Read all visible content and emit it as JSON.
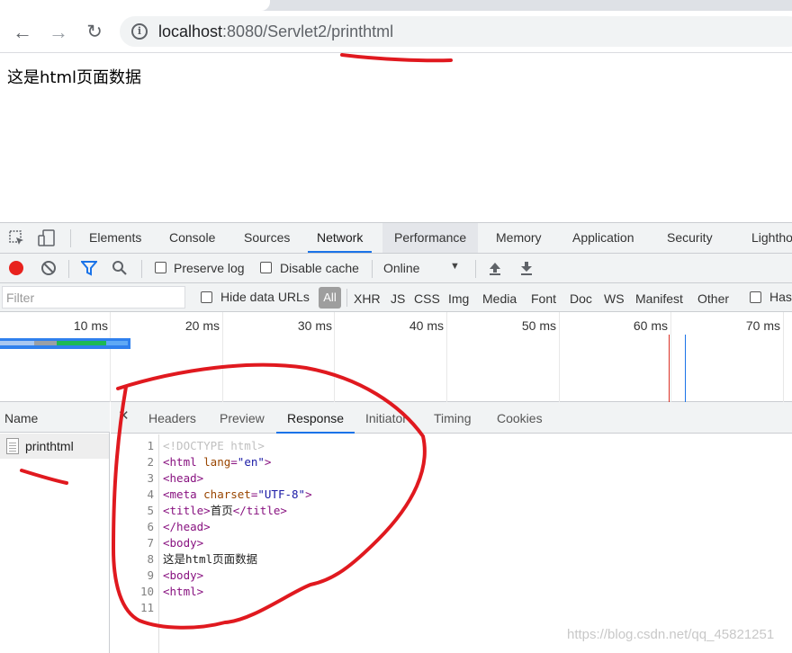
{
  "browser": {
    "url_host": "localhost",
    "url_rest": ":8080/Servlet2/printhtml"
  },
  "page": {
    "text": "这是html页面数据"
  },
  "devtools": {
    "tabs": [
      "Elements",
      "Console",
      "Sources",
      "Network",
      "Performance",
      "Memory",
      "Application",
      "Security",
      "Lighthou"
    ],
    "active_tab": "Network",
    "network_toolbar": {
      "preserve_log": "Preserve log",
      "disable_cache": "Disable cache",
      "throttling": "Online"
    },
    "filter_bar": {
      "placeholder": "Filter",
      "hide_data_urls": "Hide data URLs",
      "all": "All",
      "types": [
        "XHR",
        "JS",
        "CSS",
        "Img",
        "Media",
        "Font",
        "Doc",
        "WS",
        "Manifest",
        "Other"
      ],
      "has": "Has"
    },
    "timeline_ticks": [
      "10 ms",
      "20 ms",
      "30 ms",
      "40 ms",
      "50 ms",
      "60 ms",
      "70 ms"
    ],
    "name_column": {
      "header": "Name",
      "request": "printhtml"
    },
    "detail_tabs": [
      "Headers",
      "Preview",
      "Response",
      "Initiator",
      "Timing",
      "Cookies"
    ],
    "active_detail_tab": "Response",
    "response_lines": [
      {
        "n": "1",
        "parts": [
          {
            "c": "t-doc",
            "t": "<!DOCTYPE html>"
          }
        ]
      },
      {
        "n": "2",
        "parts": [
          {
            "c": "t-tag",
            "t": "<html "
          },
          {
            "c": "t-attr",
            "t": "lang"
          },
          {
            "c": "t-tag",
            "t": "="
          },
          {
            "c": "t-val",
            "t": "\"en\""
          },
          {
            "c": "t-tag",
            "t": ">"
          }
        ]
      },
      {
        "n": "3",
        "parts": [
          {
            "c": "t-tag",
            "t": "<head>"
          }
        ]
      },
      {
        "n": "4",
        "parts": [
          {
            "c": "t-tag",
            "t": "<meta "
          },
          {
            "c": "t-attr",
            "t": "charset"
          },
          {
            "c": "t-tag",
            "t": "="
          },
          {
            "c": "t-val",
            "t": "\"UTF-8\""
          },
          {
            "c": "t-tag",
            "t": ">"
          }
        ]
      },
      {
        "n": "5",
        "parts": [
          {
            "c": "t-tag",
            "t": "<title>"
          },
          {
            "c": "",
            "t": "首页"
          },
          {
            "c": "t-tag",
            "t": "</title>"
          }
        ]
      },
      {
        "n": "6",
        "parts": [
          {
            "c": "t-tag",
            "t": "</head>"
          }
        ]
      },
      {
        "n": "7",
        "parts": [
          {
            "c": "t-tag",
            "t": "<body>"
          }
        ]
      },
      {
        "n": "8",
        "parts": [
          {
            "c": "",
            "t": "这是html页面数据"
          }
        ]
      },
      {
        "n": "9",
        "parts": [
          {
            "c": "t-tag",
            "t": "<body>"
          }
        ]
      },
      {
        "n": "10",
        "parts": [
          {
            "c": "t-tag",
            "t": "<html>"
          }
        ]
      },
      {
        "n": "11",
        "parts": []
      }
    ]
  },
  "watermark": "https://blog.csdn.net/qq_45821251",
  "colors": {
    "annotation_red": "#e0191f",
    "accent_blue": "#1a73e8",
    "record_red": "#e8221e"
  }
}
